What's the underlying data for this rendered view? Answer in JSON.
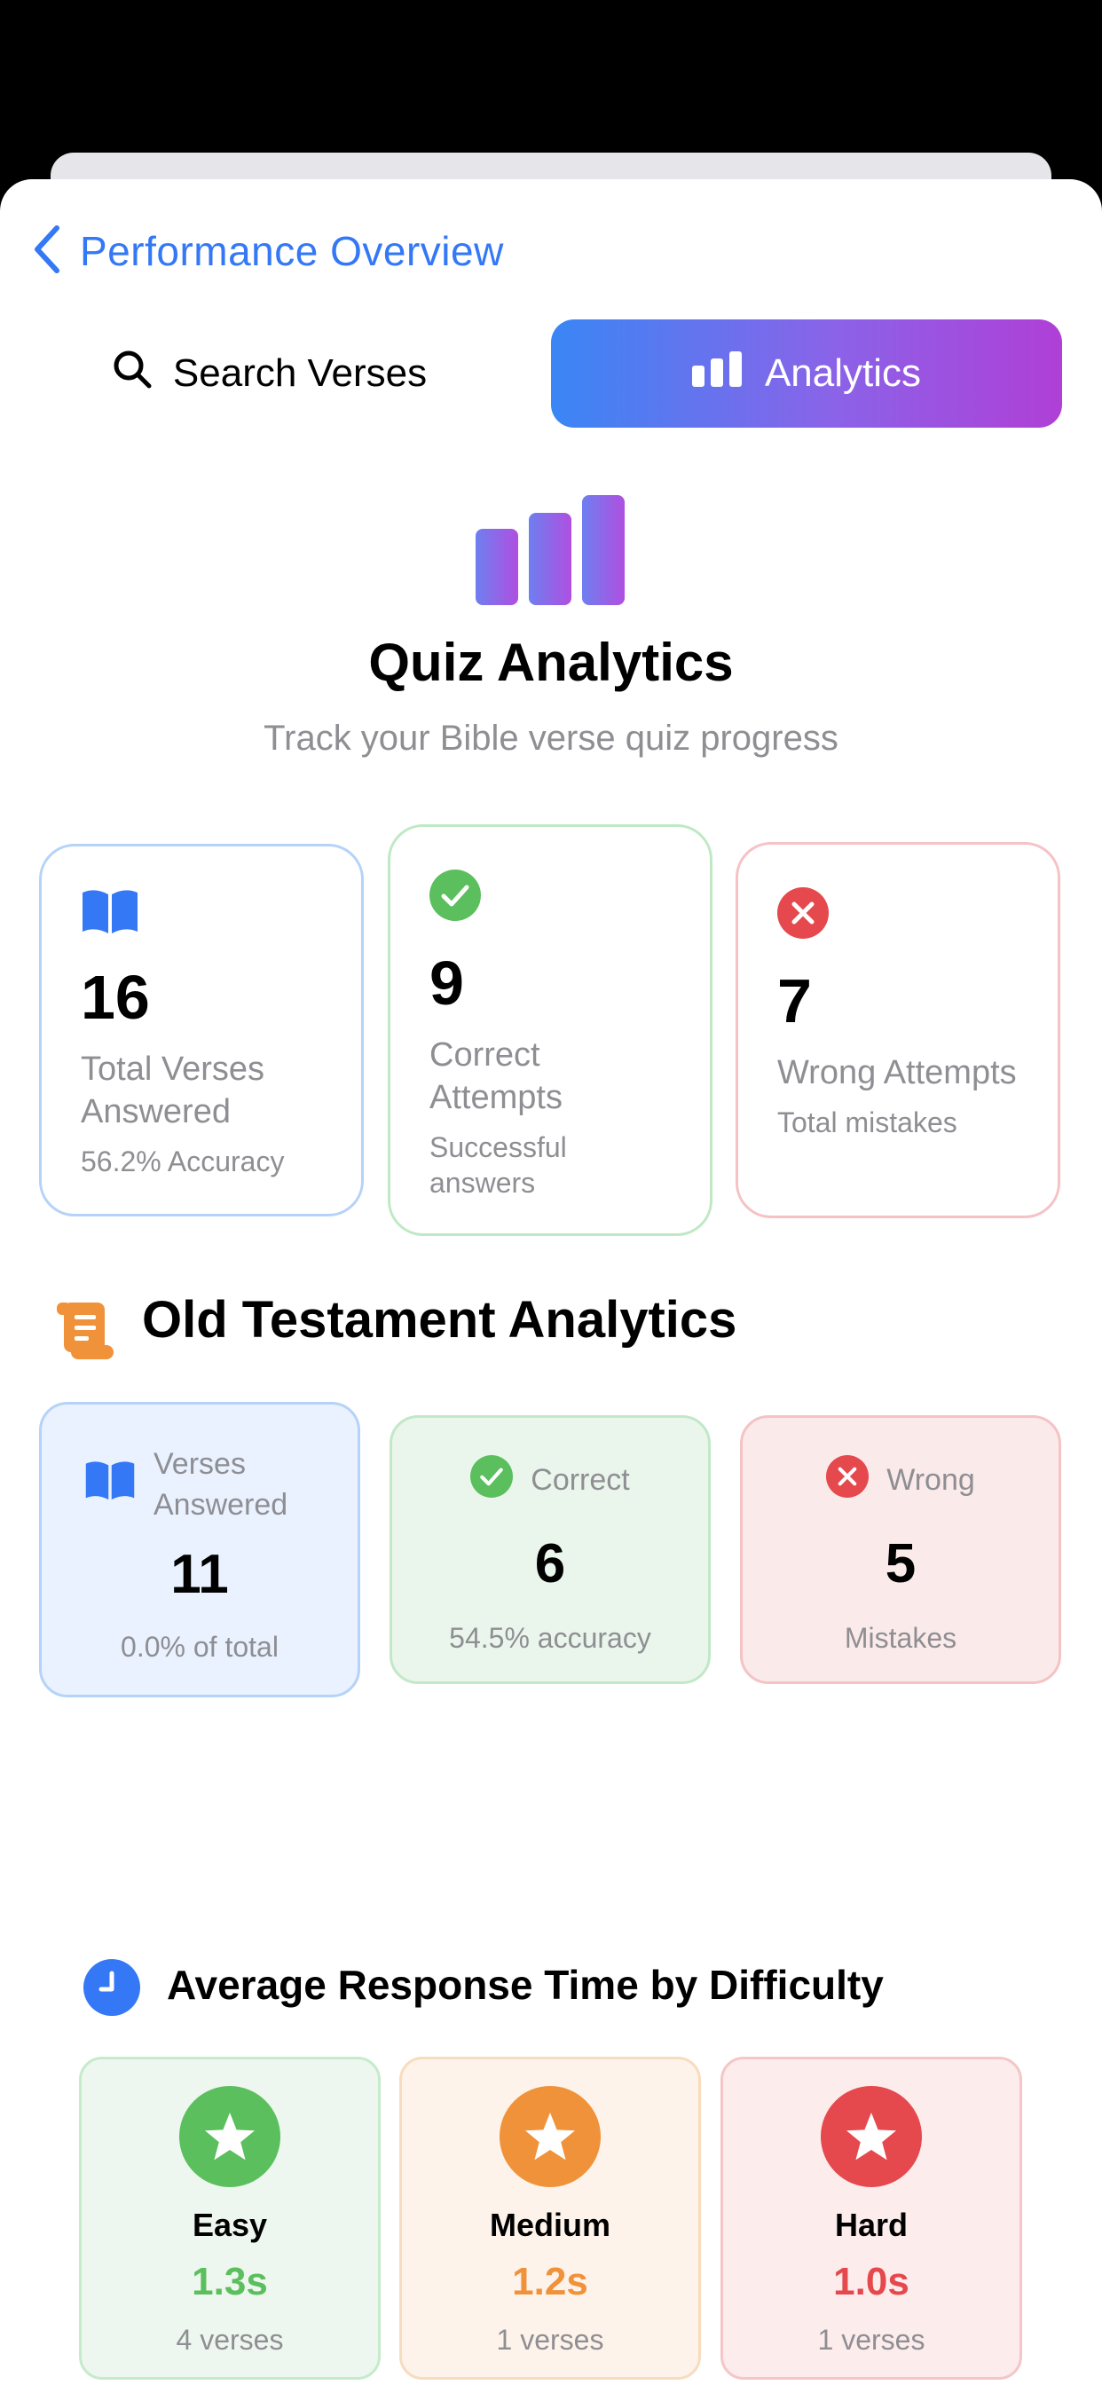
{
  "nav": {
    "back_title": "Performance Overview"
  },
  "tabs": [
    {
      "label": "Search Verses",
      "icon": "magnifying-glass",
      "active": false
    },
    {
      "label": "Analytics",
      "icon": "bar-chart",
      "active": true
    }
  ],
  "hero": {
    "title": "Quiz Analytics",
    "subtitle": "Track your Bible verse quiz progress"
  },
  "summary": {
    "total": {
      "value": "16",
      "label": "Total Verses Answered",
      "sub": "56.2% Accuracy",
      "icon": "book-icon",
      "color": "#3478f6"
    },
    "correct": {
      "value": "9",
      "label": "Correct Attempts",
      "sub": "Successful answers",
      "icon": "checkmark-circle",
      "color": "#5bbf5e"
    },
    "wrong": {
      "value": "7",
      "label": "Wrong Attempts",
      "sub": "Total mistakes",
      "icon": "x-circle",
      "color": "#e5484d"
    }
  },
  "old_testament": {
    "title": "Old Testament Analytics",
    "icon": "scroll-icon",
    "verses": {
      "label": "Verses Answered",
      "value": "11",
      "sub": "0.0% of total"
    },
    "correct": {
      "label": "Correct",
      "value": "6",
      "sub": "54.5% accuracy"
    },
    "wrong": {
      "label": "Wrong",
      "value": "5",
      "sub": "Mistakes"
    }
  },
  "response_time": {
    "title": "Average Response Time by Difficulty",
    "icon": "clock-icon",
    "levels": [
      {
        "name": "Easy",
        "time": "1.3s",
        "count": "4 verses",
        "color": "#5bbf5e"
      },
      {
        "name": "Medium",
        "time": "1.2s",
        "count": "1 verses",
        "color": "#f0923a"
      },
      {
        "name": "Hard",
        "time": "1.0s",
        "count": "1 verses",
        "color": "#e5484d"
      }
    ]
  }
}
